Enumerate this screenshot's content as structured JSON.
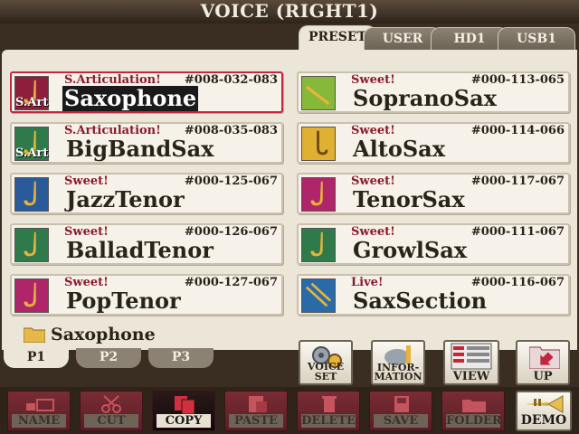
{
  "title": "VOICE (RIGHT1)",
  "tabs": [
    {
      "label": "PRESET",
      "active": true
    },
    {
      "label": "USER",
      "active": false
    },
    {
      "label": "HD1",
      "active": false
    },
    {
      "label": "USB1",
      "active": false
    }
  ],
  "voices": [
    {
      "category": "S.Articulation!",
      "number": "#008-032-083",
      "name": "Saxophone",
      "badge": "S.Art",
      "selected": true
    },
    {
      "category": "Sweet!",
      "number": "#000-113-065",
      "name": "SopranoSax"
    },
    {
      "category": "S.Articulation!",
      "number": "#008-035-083",
      "name": "BigBandSax",
      "badge": "S.Art"
    },
    {
      "category": "Sweet!",
      "number": "#000-114-066",
      "name": "AltoSax"
    },
    {
      "category": "Sweet!",
      "number": "#000-125-067",
      "name": "JazzTenor"
    },
    {
      "category": "Sweet!",
      "number": "#000-117-067",
      "name": "TenorSax"
    },
    {
      "category": "Sweet!",
      "number": "#000-126-067",
      "name": "BalladTenor"
    },
    {
      "category": "Sweet!",
      "number": "#000-111-067",
      "name": "GrowlSax"
    },
    {
      "category": "Sweet!",
      "number": "#000-127-067",
      "name": "PopTenor"
    },
    {
      "category": "Live!",
      "number": "#000-116-067",
      "name": "SaxSection"
    }
  ],
  "folder": {
    "label": "Saxophone",
    "icon": "folder-icon"
  },
  "pages": [
    {
      "label": "P1",
      "active": true
    },
    {
      "label": "P2",
      "active": false
    },
    {
      "label": "P3",
      "active": false
    }
  ],
  "actions": {
    "voice_set": "VOICE SET",
    "information_1": "INFOR-",
    "information_2": "MATION",
    "view": "VIEW",
    "up": "UP"
  },
  "bottom": {
    "name": "NAME",
    "cut": "CUT",
    "copy": "COPY",
    "paste": "PASTE",
    "delete": "DELETE",
    "save": "SAVE",
    "folder": "FOLDER",
    "demo": "DEMO"
  },
  "colors": {
    "accent_red": "#c2273f",
    "panel": "#ece6d8",
    "dark": "#2e241a"
  }
}
